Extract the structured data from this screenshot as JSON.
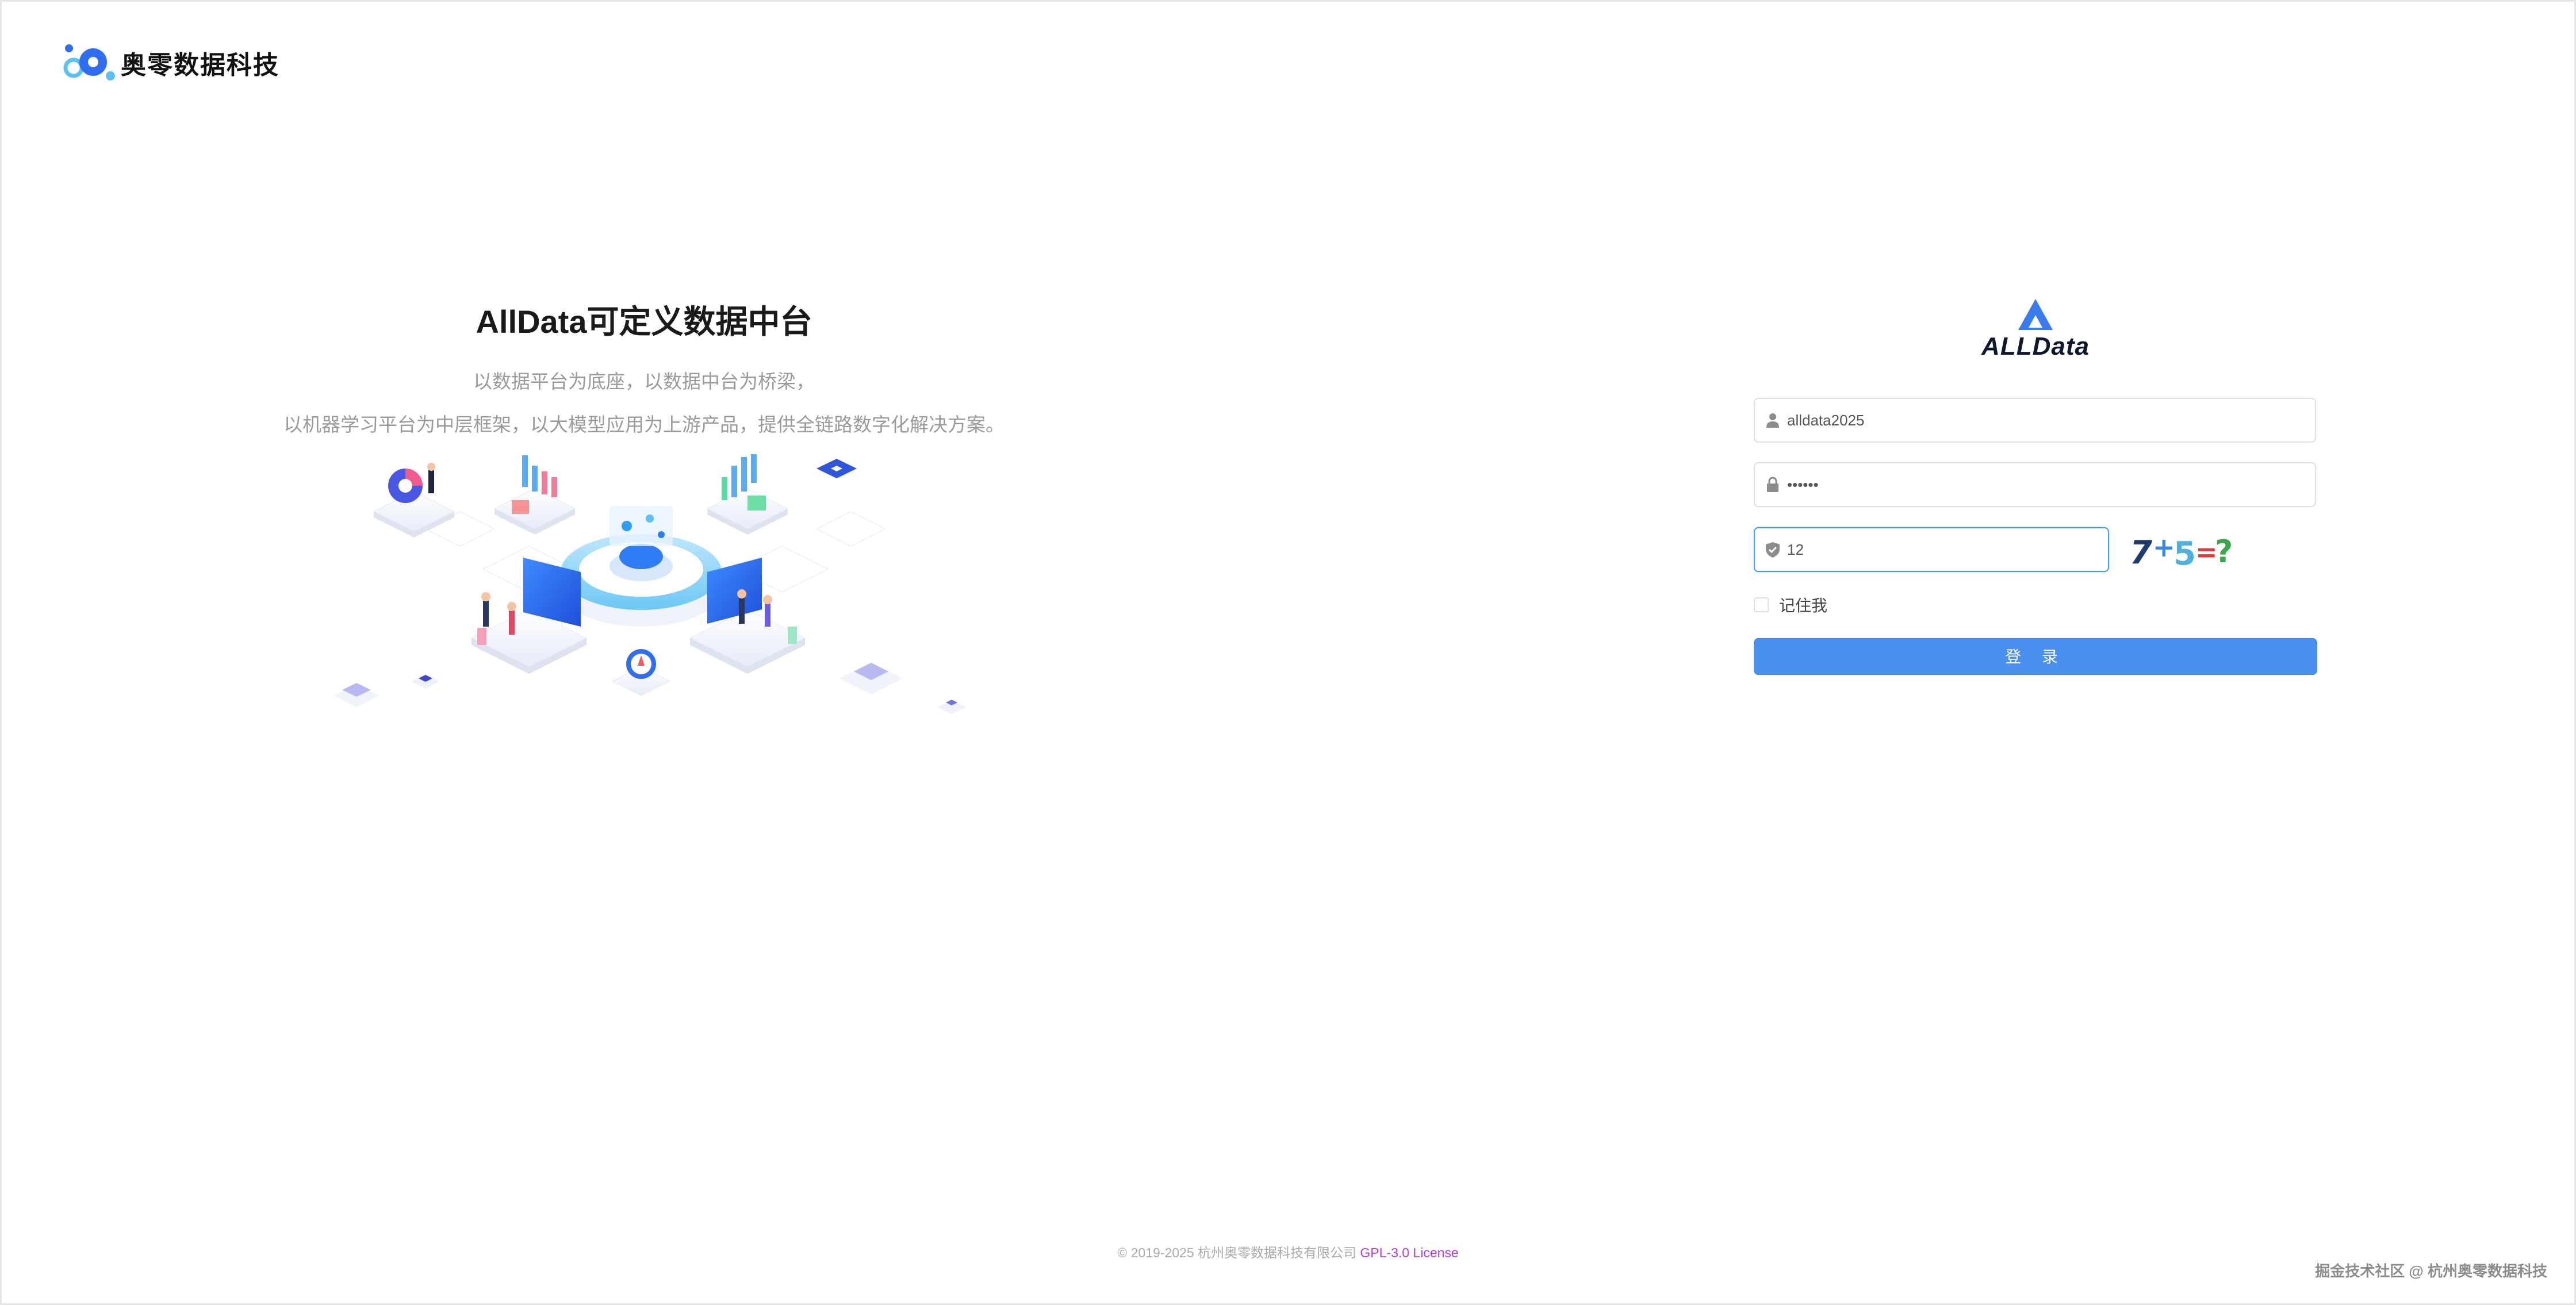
{
  "brand": {
    "name": "奥零数据科技"
  },
  "hero": {
    "title": "AllData可定义数据中台",
    "subtitle_line1": "以数据平台为底座，以数据中台为桥梁，",
    "subtitle_line2": "以机器学习平台为中层框架，以大模型应用为上游产品，提供全链路数字化解决方案。"
  },
  "login": {
    "logo_text": "ALLData",
    "username_value": "alldata2025",
    "password_value": "••••••",
    "captcha_input_value": "12",
    "captcha_text": "7+5=?",
    "remember_label": "记住我",
    "submit_label": "登 录"
  },
  "footer": {
    "copyright": "© 2019-2025 杭州奥零数据科技有限公司",
    "license_link": "GPL-3.0 License"
  },
  "watermark": "掘金技术社区 @ 杭州奥零数据科技",
  "icons": [
    "user-icon",
    "lock-icon",
    "shield-check-icon"
  ],
  "colors": {
    "primary": "#4a8ff0",
    "focus_border": "#409eff",
    "license": "#b13ed9"
  }
}
